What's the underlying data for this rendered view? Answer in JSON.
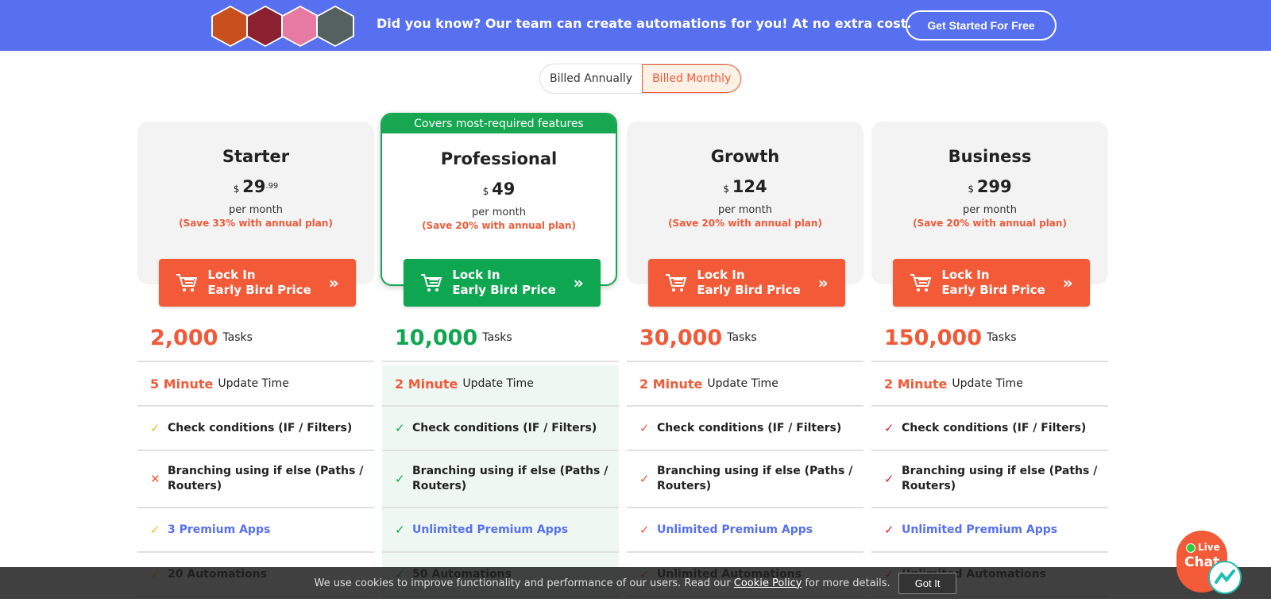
{
  "banner": {
    "text": "Did you know? Our team can create automations for you! At no extra cost.",
    "button": "Get Started For Free",
    "avatar_colors": [
      "#c8501e",
      "#8a2030",
      "#e77aa0",
      "#556060"
    ]
  },
  "billing": {
    "annual": "Billed Annually",
    "monthly": "Billed Monthly",
    "selected": "Billed Monthly"
  },
  "colors": {
    "accent": "#f25a38",
    "green": "#0fa651",
    "blue": "#5770ef"
  },
  "plans": [
    {
      "name": "Starter",
      "currency": "$",
      "price": "29",
      "cents": ".99",
      "per": "per month",
      "save": "(Save 33% with annual plan)",
      "cta1": "Lock In",
      "cta2": "Early Bird Price",
      "tasks": "2,000",
      "tasks_label": "Tasks",
      "update": "5 Minute",
      "update_label": "Update Time",
      "f1": "Check conditions (IF / Filters)",
      "f2": "Branching using if else (Paths / Routers)",
      "f3": "3 Premium Apps",
      "f4": "20 Automations",
      "m1": "✓",
      "m2": "✕",
      "mc": "#f5b82e",
      "xc": "#f05a38"
    },
    {
      "name": "Professional",
      "ribbon": "Covers most-required features",
      "currency": "$",
      "price": "49",
      "per": "per month",
      "save": "(Save 20% with annual plan)",
      "cta1": "Lock In",
      "cta2": "Early Bird Price",
      "tasks": "10,000",
      "tasks_label": "Tasks",
      "update": "2 Minute",
      "update_label": "Update Time",
      "f1": "Check conditions (IF / Filters)",
      "f2": "Branching using if else (Paths / Routers)",
      "f3": "Unlimited Premium Apps",
      "f4": "50 Automations",
      "m1": "✓",
      "m2": "✓",
      "mc": "#0fa651",
      "xc": "#0fa651"
    },
    {
      "name": "Growth",
      "currency": "$",
      "price": "124",
      "per": "per month",
      "save": "(Save 20% with annual plan)",
      "cta1": "Lock In",
      "cta2": "Early Bird Price",
      "tasks": "30,000",
      "tasks_label": "Tasks",
      "update": "2 Minute",
      "update_label": "Update Time",
      "f1": "Check conditions (IF / Filters)",
      "f2": "Branching using if else (Paths / Routers)",
      "f3": "Unlimited Premium Apps",
      "f4": "Unlimited Automations",
      "m1": "✓",
      "m2": "✓",
      "mc": "#f05a38",
      "xc": "#f05a38"
    },
    {
      "name": "Business",
      "currency": "$",
      "price": "299",
      "per": "per month",
      "save": "(Save 20% with annual plan)",
      "cta1": "Lock In",
      "cta2": "Early Bird Price",
      "tasks": "150,000",
      "tasks_label": "Tasks",
      "update": "2 Minute",
      "update_label": "Update Time",
      "f1": "Check conditions (IF / Filters)",
      "f2": "Branching using if else (Paths / Routers)",
      "f3": "Unlimited Premium Apps",
      "f4": "Unlimited Automations",
      "m1": "✓",
      "m2": "✓",
      "mc": "#d42a2a",
      "xc": "#d42a2a"
    }
  ],
  "cookie": {
    "text": "We use cookies to improve functionality and performance of our users. Read our",
    "link": "Cookie Policy",
    "after": "for more details.",
    "button": "Got It"
  },
  "chat": {
    "live": "Live",
    "chat": "Chat"
  }
}
